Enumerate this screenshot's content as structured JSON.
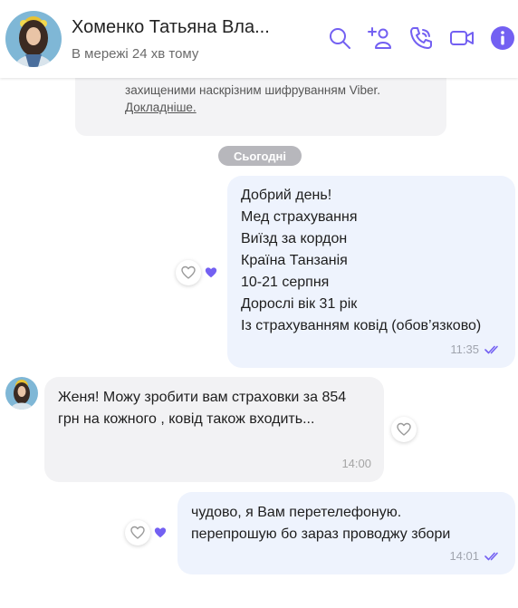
{
  "header": {
    "contact_name": "Хоменко Татьяна Вла...",
    "status": "В мережі 24 хв тому",
    "icons": [
      "search-icon",
      "add-participant-icon",
      "call-icon",
      "video-call-icon",
      "info-icon"
    ],
    "accent_color": "#7360f2"
  },
  "chat": {
    "encryption_notice": "захищеними наскрізним шифруванням Viber.",
    "encryption_more": "Докладніше.",
    "date_label": "Сьогодні",
    "messages": [
      {
        "direction": "outgoing",
        "text": "Добрий день!\nМед страхування\nВиїзд за кордон\nКраїна Танзанія\n10-21 серпня\nДорослі вік 31 рік\nІз страхуванням ковід (обов’язково)",
        "time": "11:35",
        "status": "read"
      },
      {
        "direction": "incoming",
        "text": "Женя! Можу зробити вам страховки за 854 грн на кожного , ковід також входить...",
        "time": "14:00"
      },
      {
        "direction": "outgoing",
        "text": "чудово, я Вам перетелефоную.\nперепрошую бо зараз проводжу збори",
        "time": "14:01",
        "status": "read"
      }
    ]
  }
}
